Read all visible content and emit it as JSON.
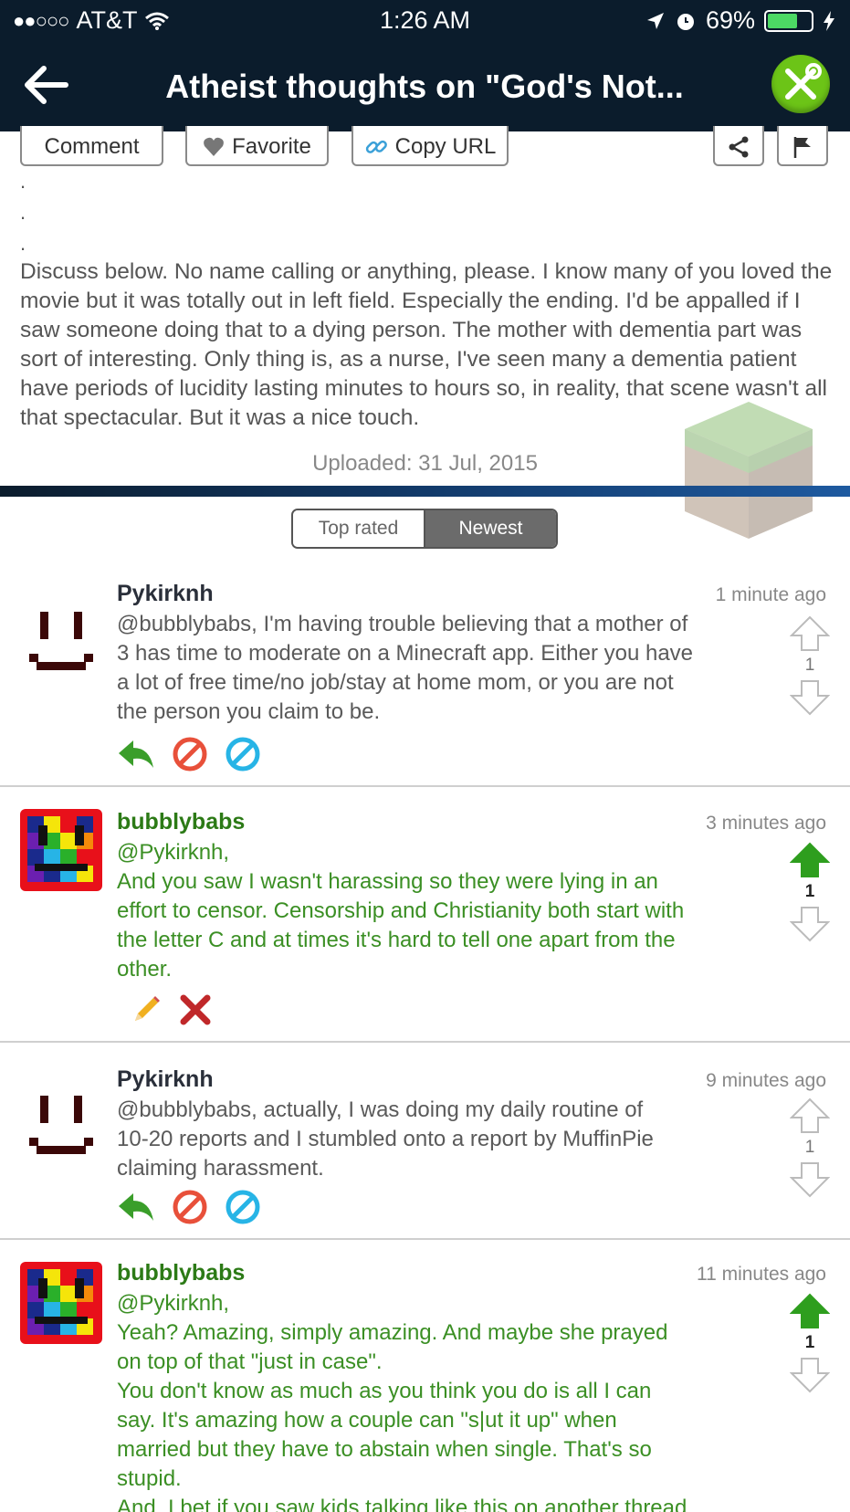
{
  "status_bar": {
    "carrier": "AT&T",
    "signal_dots": "●●○○○",
    "time": "1:26 AM",
    "battery": "69%",
    "battery_level": 0.69
  },
  "nav": {
    "title": "Atheist thoughts on \"God's Not..."
  },
  "actions": {
    "comment": "Comment",
    "favorite": "Favorite",
    "copy_url": "Copy URL"
  },
  "post": {
    "dots": [
      ".",
      ".",
      "."
    ],
    "description": "Discuss below.  No name calling or anything, please.  I know many of you loved the movie but it was totally out in left field.  Especially the ending.  I'd be appalled if I saw someone doing that to a dying person.  The mother with dementia part was sort of interesting.  Only thing is, as a nurse, I've seen many a dementia patient have periods of lucidity lasting minutes to hours so, in reality, that scene wasn't all that spectacular.  But it was a nice touch.",
    "uploaded": "Uploaded: 31 Jul, 2015"
  },
  "sort": {
    "top_rated": "Top rated",
    "newest": "Newest",
    "selected": "Newest"
  },
  "colors": {
    "header_bg": "#0b1c2c",
    "accent_green": "#6cc417",
    "own_comment_text": "#3b8f24",
    "upvote_active": "#2e9e1e"
  },
  "comments": [
    {
      "author": "Pykirknh",
      "time": "1 minute ago",
      "lines": [
        "@bubblybabs, I'm having trouble believing that a mother of",
        "3 has time to moderate on a Minecraft app. Either you have",
        "a lot of free time/no job/stay at home mom, or you are not",
        "the person you claim to be."
      ],
      "votes": "1",
      "upvoted": false
    },
    {
      "author": "bubblybabs",
      "time": "3 minutes ago",
      "lines": [
        "@Pykirknh,",
        "And you saw I wasn't harassing so they were lying in an",
        "effort to censor. Censorship and Christianity both start with",
        "the letter C and at times it's hard to tell one apart from the",
        "other."
      ],
      "votes": "1",
      "upvoted": true
    },
    {
      "author": "Pykirknh",
      "time": "9 minutes ago",
      "lines": [
        "@bubblybabs, actually, I was doing my daily routine of",
        "10-20 reports and I stumbled onto a report by MuffinPie",
        "claiming harassment."
      ],
      "votes": "1",
      "upvoted": false
    },
    {
      "author": "bubblybabs",
      "time": "11 minutes ago",
      "lines": [
        "@Pykirknh,",
        "Yeah? Amazing, simply amazing. And maybe she prayed",
        "on top of that \"just in case\".",
        "You don't know as much as you think you do is all I can",
        "say. It's amazing how a couple can \"s|ut it up\" when",
        "married but they have to abstain when single. That's so",
        "stupid.",
        "And, I bet if you saw kids talking like this on another thread"
      ],
      "votes": "1",
      "upvoted": true
    }
  ]
}
